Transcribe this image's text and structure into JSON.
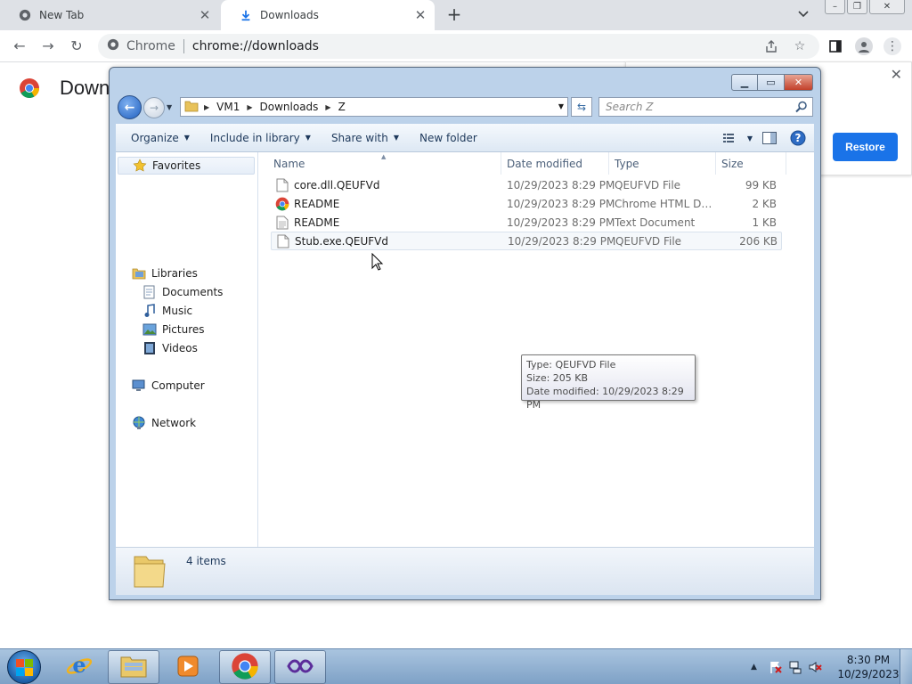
{
  "browser": {
    "tabs": [
      {
        "title": "New Tab",
        "icon": "chrome-logo-icon"
      },
      {
        "title": "Downloads",
        "icon": "download-icon"
      }
    ],
    "omnibox": {
      "site": "Chrome",
      "url": "chrome://downloads"
    }
  },
  "downloads_page": {
    "heading": "Down",
    "restore_label": "Restore",
    "close_symbol": "✕"
  },
  "explorer": {
    "breadcrumb": [
      "VM1",
      "Downloads",
      "Z"
    ],
    "search_placeholder": "Search Z",
    "commands": {
      "organize": "Organize",
      "include": "Include in library",
      "share": "Share with",
      "new_folder": "New folder"
    },
    "nav": {
      "favorites": "Favorites",
      "libraries": "Libraries",
      "documents": "Documents",
      "music": "Music",
      "pictures": "Pictures",
      "videos": "Videos",
      "computer": "Computer",
      "network": "Network"
    },
    "columns": [
      "Name",
      "Date modified",
      "Type",
      "Size"
    ],
    "files": [
      {
        "name": "core.dll.QEUFVd",
        "date": "10/29/2023 8:29 PM",
        "type": "QEUFVD File",
        "size": "99 KB",
        "icon": "blank-file-icon"
      },
      {
        "name": "README",
        "date": "10/29/2023 8:29 PM",
        "type": "Chrome HTML Do...",
        "size": "2 KB",
        "icon": "chrome-html-file-icon"
      },
      {
        "name": "README",
        "date": "10/29/2023 8:29 PM",
        "type": "Text Document",
        "size": "1 KB",
        "icon": "text-file-icon"
      },
      {
        "name": "Stub.exe.QEUFVd",
        "date": "10/29/2023 8:29 PM",
        "type": "QEUFVD File",
        "size": "206 KB",
        "icon": "blank-file-icon"
      }
    ],
    "tooltip": {
      "type": "Type: QEUFVD File",
      "size": "Size: 205 KB",
      "modified": "Date modified: 10/29/2023 8:29 PM"
    },
    "status": {
      "count": "4 items"
    }
  },
  "taskbar": {
    "clock_time": "8:30 PM",
    "clock_date": "10/29/2023",
    "apps": [
      "internet-explorer-icon",
      "file-explorer-icon",
      "media-player-icon",
      "chrome-icon",
      "visual-studio-icon"
    ]
  },
  "colors": {
    "accent": "#1a73e8",
    "explorer_frame": "#bcd2ea",
    "taskbar": "#7ea1c6"
  }
}
